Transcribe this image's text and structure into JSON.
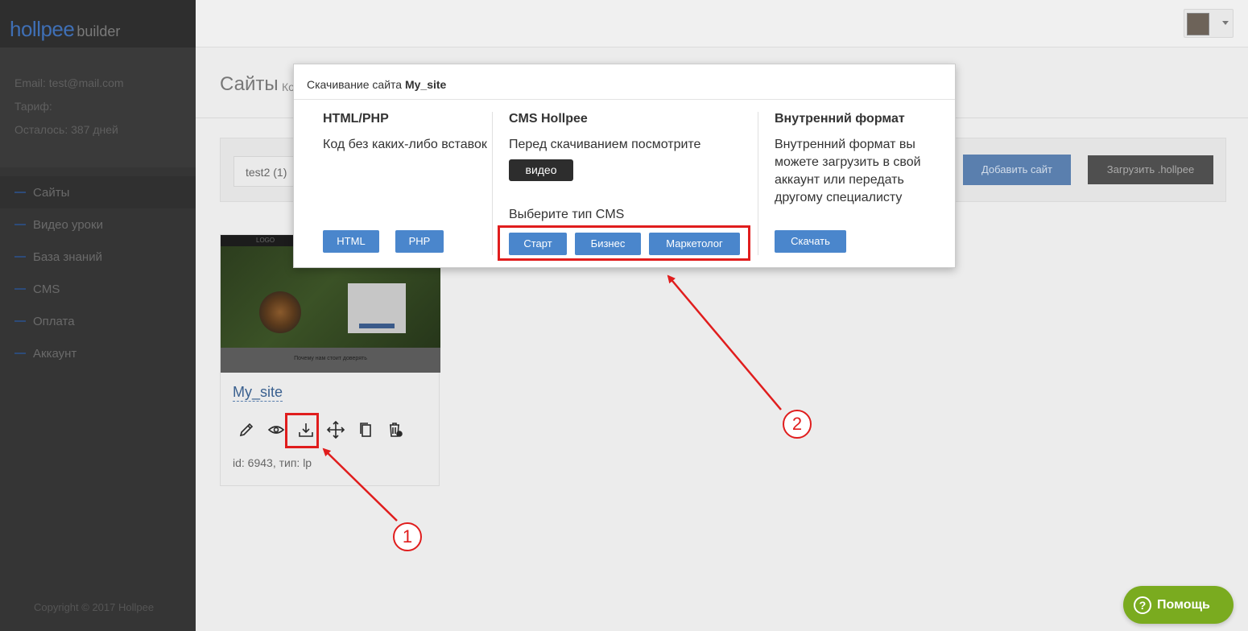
{
  "app": {
    "logo_part1": "hollpee",
    "logo_part2": "builder"
  },
  "user": {
    "email_label": "Email: test@mail.com",
    "plan_label": "Тариф:",
    "remaining_label": "Осталось: 387 дней"
  },
  "sidebar": {
    "items": [
      {
        "label": "Сайты"
      },
      {
        "label": "Видео уроки"
      },
      {
        "label": "База знаний"
      },
      {
        "label": "CMS"
      },
      {
        "label": "Оплата"
      },
      {
        "label": "Аккаунт"
      }
    ],
    "copyright": "Copyright © 2017 Hollpee"
  },
  "page": {
    "title": "Сайты",
    "subtitle": "Ко"
  },
  "filter": {
    "selected": "test2 (1)"
  },
  "toolbar": {
    "add_label": "Добавить сайт",
    "upload_label": "Загрузить .hollpee"
  },
  "site": {
    "thumb_logo": "LOGO",
    "thumb_caption": "Почему нам стоит доверять",
    "name": "My_site",
    "meta": "id: 6943, тип: lp"
  },
  "modal": {
    "title_prefix": "Скачивание сайта",
    "title_site": "My_site",
    "col1": {
      "heading": "HTML/PHP",
      "text": "Код без каких-либо вставок",
      "btn_html": "HTML",
      "btn_php": "PHP"
    },
    "col2": {
      "heading": "CMS Hollpee",
      "text": "Перед скачиванием посмотрите",
      "video_btn": "видео",
      "choose_label": "Выберите тип CMS",
      "btn_start": "Старт",
      "btn_business": "Бизнес",
      "btn_marketer": "Маркетолог"
    },
    "col3": {
      "heading": "Внутренний формат",
      "text": "Внутренний формат вы можете загрузить в свой аккаунт или передать другому специалисту",
      "download_btn": "Скачать"
    }
  },
  "annotations": {
    "badge1": "1",
    "badge2": "2"
  },
  "help": {
    "label": "Помощь",
    "icon": "?"
  },
  "colors": {
    "accent": "#4a86cc",
    "annotation": "#e01d1d",
    "help": "#7aab1f"
  }
}
